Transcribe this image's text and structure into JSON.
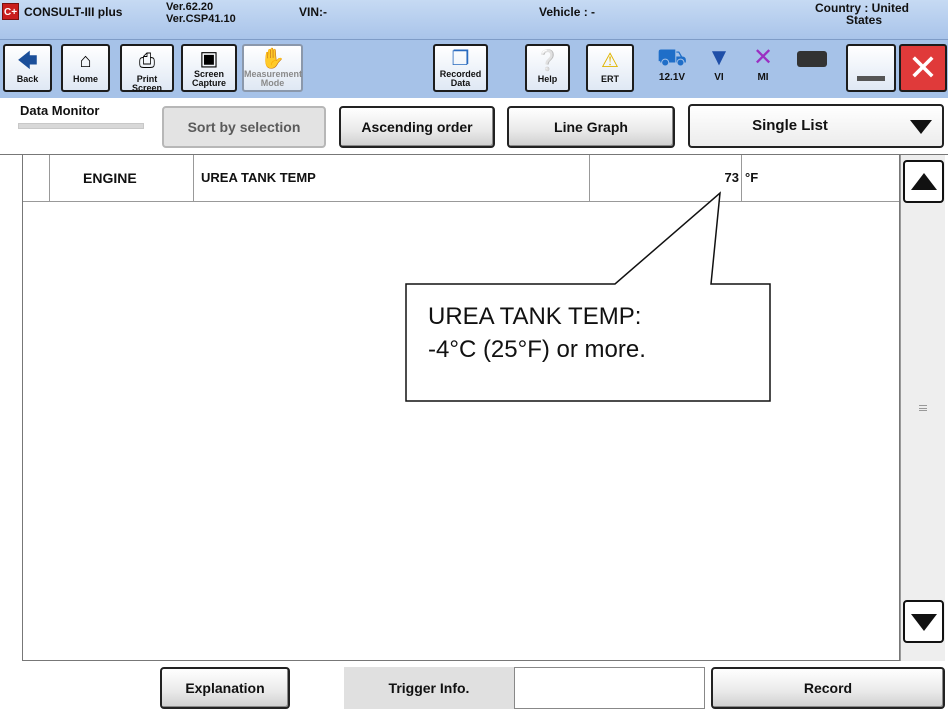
{
  "titlebar": {
    "app_name": "CONSULT-III plus",
    "logo_text": "C+",
    "version_line1": "Ver.62.20",
    "version_line2": "Ver.CSP41.10",
    "vin": "VIN:-",
    "vehicle": "Vehicle : -",
    "country_line1": "Country : United",
    "country_line2": "States"
  },
  "toolbar": {
    "back": "Back",
    "home": "Home",
    "print_screen": "Print Screen",
    "screen_capture_1": "Screen",
    "screen_capture_2": "Capture",
    "measurement_1": "Measurement",
    "measurement_2": "Mode",
    "recorded_1": "Recorded",
    "recorded_2": "Data",
    "help": "Help",
    "ert": "ERT",
    "voltage": "12.1V",
    "vi": "VI",
    "mi": "MI"
  },
  "data_monitor": {
    "title": "Data Monitor",
    "sort_by_selection": "Sort by selection",
    "ascending_order": "Ascending order",
    "line_graph": "Line Graph",
    "list_mode": "Single List"
  },
  "rows": [
    {
      "system": "ENGINE",
      "item": "UREA TANK TEMP",
      "value": "73",
      "unit": "°F"
    }
  ],
  "bottom": {
    "explanation": "Explanation",
    "trigger_info": "Trigger Info.",
    "record": "Record"
  },
  "callout": {
    "line1": "UREA TANK TEMP:",
    "line2": "-4°C (25°F) or more."
  },
  "colors": {
    "title_bar": "#b8cff0",
    "toolbar": "#a6c2e8",
    "close_red": "#e03a3a",
    "logo_red": "#c91e1e"
  }
}
